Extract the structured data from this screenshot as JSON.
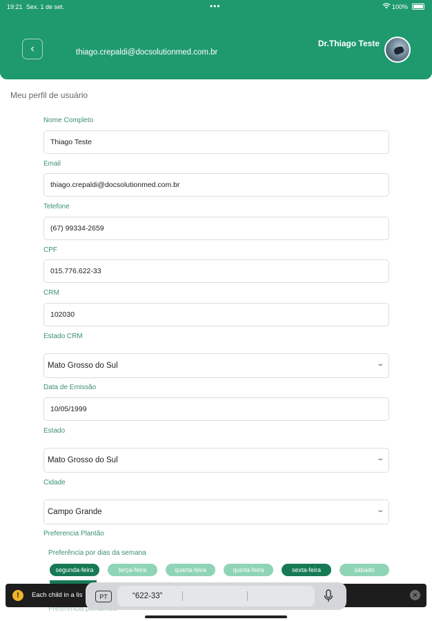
{
  "status_bar": {
    "time": "19:21",
    "date": "Sex. 1 de set.",
    "battery": "100%",
    "wifi_icon": "wifi-icon",
    "dots": "•••"
  },
  "header": {
    "email": "thiago.crepaldi@docsolutionmed.com.br",
    "doctor_name": "Dr.Thiago Teste",
    "back_icon": "chevron-left-icon",
    "back_glyph": "‹",
    "brand_color": "#1f9a6f"
  },
  "page": {
    "title": "Meu perfil de usuário"
  },
  "form": {
    "nome_label": "Nome Completo",
    "nome_value": "Thiago Teste",
    "email_label": "Email",
    "email_value": "thiago.crepaldi@docsolutionmed.com.br",
    "telefone_label": "Telefone",
    "telefone_value": "(67) 99334-2659",
    "cpf_label": "CPF",
    "cpf_value": "015.776.622-33",
    "crm_label": "CRM",
    "crm_value": "102030",
    "estado_crm_label": "Estado CRM",
    "estado_crm_value": "Mato Grosso do Sul",
    "data_emissao_label": "Data de Emissão",
    "data_emissao_value": "10/05/1999",
    "estado_label": "Estado",
    "estado_value": "Mato Grosso do Sul",
    "cidade_label": "Cidade",
    "cidade_value": "Campo Grande",
    "chevron_glyph": "⌄"
  },
  "plantao": {
    "section_label": "Preferencia Plantão",
    "dias_label": "Preferência por dias da semana",
    "days": [
      {
        "label": "segunda-feira",
        "selected": true
      },
      {
        "label": "terça-feira",
        "selected": false
      },
      {
        "label": "quarta-feira",
        "selected": false
      },
      {
        "label": "quinta-feira",
        "selected": false
      },
      {
        "label": "sexta-feira",
        "selected": true
      },
      {
        "label": "sábado",
        "selected": false
      }
    ],
    "turnos_label": "Preferência por turnos",
    "selected_color": "#177a55",
    "unselected_color": "#8fd4b6"
  },
  "toast": {
    "message": "Each child in a list should have a unique key prop.",
    "warn_glyph": "!",
    "close_glyph": "×"
  },
  "keyboard": {
    "lang": "PT",
    "suggestion": "“622-33”"
  }
}
